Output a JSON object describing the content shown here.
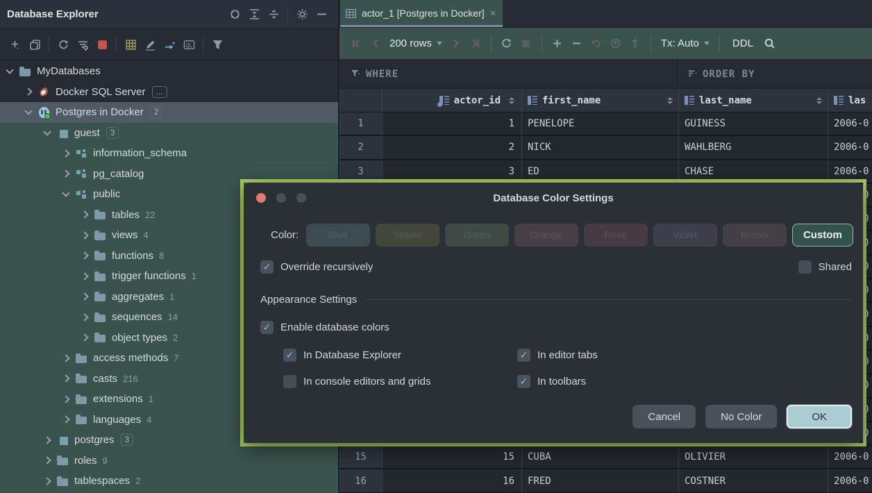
{
  "colors": {
    "database_color_green": "#3a534e",
    "selection": "#4f5a64",
    "dialog_highlight_border": "#a9ca62",
    "accent_check": "#79c6cd",
    "stop_red": "#c75450",
    "ok_button": "#a9cdd3"
  },
  "left_panel": {
    "title": "Database Explorer",
    "title_icons": [
      "locate-icon",
      "expand-all-icon",
      "collapse-all-icon",
      "settings-icon",
      "hide-icon"
    ],
    "toolbar_icons": [
      "add-icon",
      "copy-icon",
      "refresh-icon",
      "data-source-properties-icon",
      "stop-icon",
      "open-table-icon",
      "edit-icon",
      "scroll-to-source-icon",
      "query-console-icon",
      "filter-icon"
    ],
    "tree": [
      {
        "label": "MyDatabases",
        "level": 0,
        "chevron": "down",
        "icon": "folder-icon",
        "zone": "dark"
      },
      {
        "label": "Docker SQL Server",
        "level": 1,
        "chevron": "right",
        "icon": "mssql-icon",
        "badge": "...",
        "zone": "dark"
      },
      {
        "label": "Postgres in Docker",
        "level": 1,
        "chevron": "down",
        "icon": "postgres-icon",
        "badge": "2",
        "selected": true
      },
      {
        "label": "guest",
        "level": 2,
        "chevron": "down",
        "icon": "database-icon",
        "badge": "3"
      },
      {
        "label": "information_schema",
        "level": 3,
        "chevron": "right",
        "icon": "schema-icon"
      },
      {
        "label": "pg_catalog",
        "level": 3,
        "chevron": "right",
        "icon": "schema-icon"
      },
      {
        "label": "public",
        "level": 3,
        "chevron": "down",
        "icon": "schema-icon"
      },
      {
        "label": "tables",
        "level": 4,
        "chevron": "right",
        "icon": "folder-icon",
        "count": "22"
      },
      {
        "label": "views",
        "level": 4,
        "chevron": "right",
        "icon": "folder-icon",
        "count": "4"
      },
      {
        "label": "functions",
        "level": 4,
        "chevron": "right",
        "icon": "folder-icon",
        "count": "8"
      },
      {
        "label": "trigger functions",
        "level": 4,
        "chevron": "right",
        "icon": "folder-icon",
        "count": "1"
      },
      {
        "label": "aggregates",
        "level": 4,
        "chevron": "right",
        "icon": "folder-icon",
        "count": "1"
      },
      {
        "label": "sequences",
        "level": 4,
        "chevron": "right",
        "icon": "folder-icon",
        "count": "14"
      },
      {
        "label": "object types",
        "level": 4,
        "chevron": "right",
        "icon": "folder-icon",
        "count": "2"
      },
      {
        "label": "access methods",
        "level": 3,
        "chevron": "right",
        "icon": "folder-icon",
        "count": "7"
      },
      {
        "label": "casts",
        "level": 3,
        "chevron": "right",
        "icon": "folder-icon",
        "count": "216"
      },
      {
        "label": "extensions",
        "level": 3,
        "chevron": "right",
        "icon": "folder-icon",
        "count": "1"
      },
      {
        "label": "languages",
        "level": 3,
        "chevron": "right",
        "icon": "folder-icon",
        "count": "4"
      },
      {
        "label": "postgres",
        "level": 2,
        "chevron": "right",
        "icon": "database-icon",
        "badge": "3"
      },
      {
        "label": "roles",
        "level": 2,
        "chevron": "right",
        "icon": "folder-icon",
        "count": "9"
      },
      {
        "label": "tablespaces",
        "level": 2,
        "chevron": "right",
        "icon": "folder-icon",
        "count": "2"
      }
    ]
  },
  "right_panel": {
    "tab": {
      "label": "actor_1 [Postgres in Docker]",
      "icon": "table-icon",
      "close_icon": "close-icon"
    },
    "toolbar": {
      "page_size": "200 rows",
      "tx_mode": "Tx: Auto",
      "ddl": "DDL",
      "icons": [
        "first-page-icon",
        "previous-page-icon",
        "next-page-icon",
        "last-page-icon",
        "reload-icon",
        "stop-icon",
        "add-row-icon",
        "delete-row-icon",
        "revert-icon",
        "commit-icon",
        "upload-icon",
        "search-icon"
      ]
    },
    "filter": {
      "where": "WHERE",
      "order_by": "ORDER BY"
    },
    "grid": {
      "columns": [
        {
          "label": "actor_id",
          "primary_key": true
        },
        {
          "label": "first_name"
        },
        {
          "label": "last_name"
        },
        {
          "label": "las"
        }
      ],
      "rows": [
        {
          "n": "1",
          "id": "1",
          "first": "PENELOPE",
          "last": "GUINESS",
          "upd": "2006-0"
        },
        {
          "n": "2",
          "id": "2",
          "first": "NICK",
          "last": "WAHLBERG",
          "upd": "2006-0"
        },
        {
          "n": "3",
          "id": "3",
          "first": "ED",
          "last": "CHASE",
          "upd": "2006-0"
        },
        {
          "n": "",
          "id": "",
          "first": "",
          "last": "",
          "upd": "2006-0"
        },
        {
          "n": "",
          "id": "",
          "first": "",
          "last": "",
          "upd": "2006-0"
        },
        {
          "n": "",
          "id": "",
          "first": "",
          "last": "",
          "upd": "2006-0"
        },
        {
          "n": "",
          "id": "",
          "first": "",
          "last": "",
          "upd": "2006-0"
        },
        {
          "n": "",
          "id": "",
          "first": "",
          "last": "",
          "upd": "2006-0"
        },
        {
          "n": "",
          "id": "",
          "first": "",
          "last": "",
          "upd": "2006-0"
        },
        {
          "n": "",
          "id": "",
          "first": "",
          "last": "",
          "upd": "2006-0"
        },
        {
          "n": "",
          "id": "",
          "first": "",
          "last": "",
          "upd": "2006-0"
        },
        {
          "n": "",
          "id": "",
          "first": "",
          "last": "",
          "upd": "2006-0"
        },
        {
          "n": "",
          "id": "",
          "first": "",
          "last": "",
          "upd": "2006-0"
        },
        {
          "n": "",
          "id": "",
          "first": "",
          "last": "",
          "upd": "2006-0"
        },
        {
          "n": "15",
          "id": "15",
          "first": "CUBA",
          "last": "OLIVIER",
          "upd": "2006-0"
        },
        {
          "n": "16",
          "id": "16",
          "first": "FRED",
          "last": "COSTNER",
          "upd": "2006-0"
        }
      ]
    }
  },
  "dialog": {
    "title": "Database Color Settings",
    "color_label": "Color:",
    "swatches": [
      {
        "label": "Blue",
        "color": "#3b4a53"
      },
      {
        "label": "Yellow",
        "color": "#43473b"
      },
      {
        "label": "Green",
        "color": "#3e4a43"
      },
      {
        "label": "Orange",
        "color": "#473f44"
      },
      {
        "label": "Rose",
        "color": "#473a43"
      },
      {
        "label": "Violet",
        "color": "#3f3e4d"
      },
      {
        "label": "Brown",
        "color": "#443f46"
      }
    ],
    "custom_label": "Custom",
    "override_label": "Override recursively",
    "override_checked": true,
    "shared_label": "Shared",
    "shared_checked": false,
    "appearance_title": "Appearance Settings",
    "enable_label": "Enable database colors",
    "enable_checked": true,
    "in_explorer_label": "In Database Explorer",
    "in_explorer_checked": true,
    "in_tabs_label": "In editor tabs",
    "in_tabs_checked": true,
    "in_console_label": "In console editors and grids",
    "in_console_checked": false,
    "in_toolbars_label": "In toolbars",
    "in_toolbars_checked": true,
    "buttons": {
      "cancel": "Cancel",
      "no_color": "No Color",
      "ok": "OK"
    }
  }
}
